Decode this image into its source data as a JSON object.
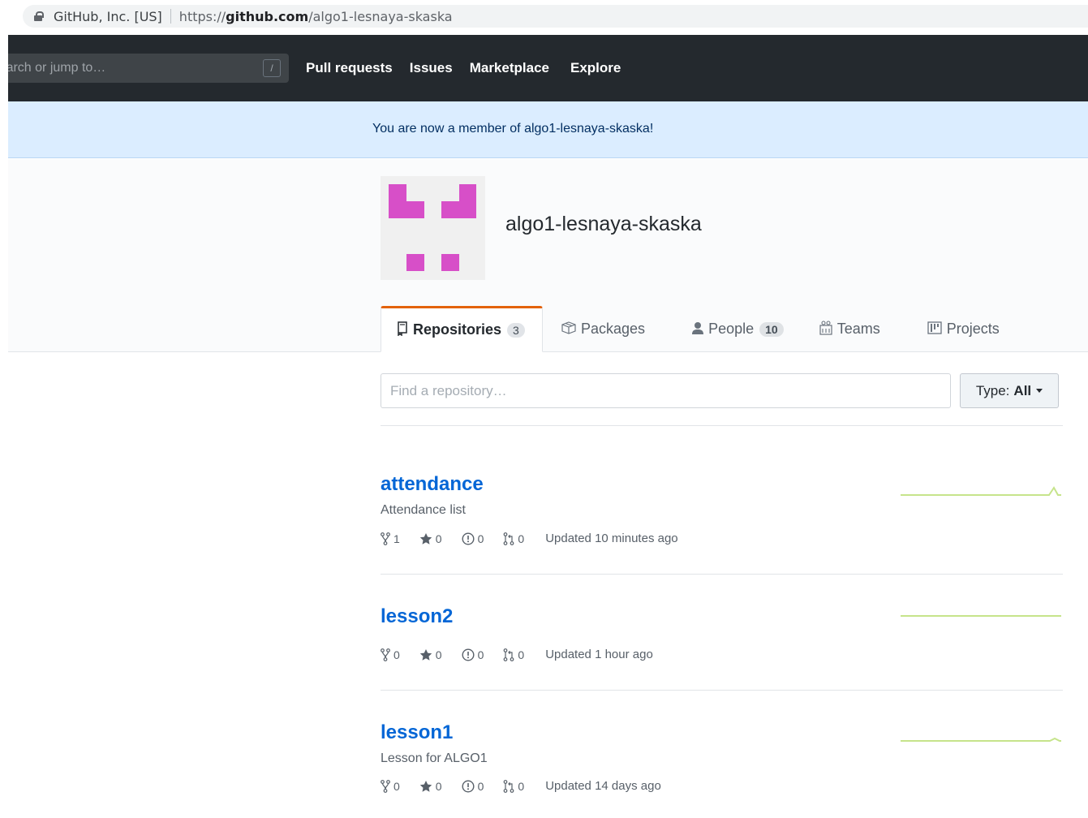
{
  "browser": {
    "site_org": "GitHub, Inc. [US]",
    "url_prefix": "https://",
    "url_host": "github.com",
    "url_path": "/algo1-lesnaya-skaska"
  },
  "header": {
    "search_placeholder": "Search or jump to…",
    "search_shortcut": "/",
    "nav": [
      "Pull requests",
      "Issues",
      "Marketplace",
      "Explore"
    ]
  },
  "flash": {
    "message": "You are now a member of algo1-lesnaya-skaska!"
  },
  "org": {
    "name": "algo1-lesnaya-skaska",
    "avatar_color": "#d74fc8"
  },
  "tabs": [
    {
      "label": "Repositories",
      "counter": "3",
      "icon": "repo-icon",
      "selected": true
    },
    {
      "label": "Packages",
      "counter": "",
      "icon": "package-icon",
      "selected": false
    },
    {
      "label": "People",
      "counter": "10",
      "icon": "person-icon",
      "selected": false
    },
    {
      "label": "Teams",
      "counter": "",
      "icon": "teams-icon",
      "selected": false
    },
    {
      "label": "Projects",
      "counter": "",
      "icon": "project-icon",
      "selected": false
    }
  ],
  "filter": {
    "placeholder": "Find a repository…",
    "type_label": "Type:",
    "type_value": "All"
  },
  "repos": [
    {
      "name": "attendance",
      "description": "Attendance list",
      "forks": "1",
      "stars": "0",
      "issues": "0",
      "pulls": "0",
      "updated": "Updated 10 minutes ago"
    },
    {
      "name": "lesson2",
      "description": "",
      "forks": "0",
      "stars": "0",
      "issues": "0",
      "pulls": "0",
      "updated": "Updated 1 hour ago"
    },
    {
      "name": "lesson1",
      "description": "Lesson for ALGO1",
      "forks": "0",
      "stars": "0",
      "issues": "0",
      "pulls": "0",
      "updated": "Updated 14 days ago"
    }
  ],
  "colors": {
    "header_bg": "#24292e",
    "flash_bg": "#dbedff",
    "link": "#0366d6",
    "tab_accent": "#e36209",
    "sparkline": "#c6e48b"
  }
}
